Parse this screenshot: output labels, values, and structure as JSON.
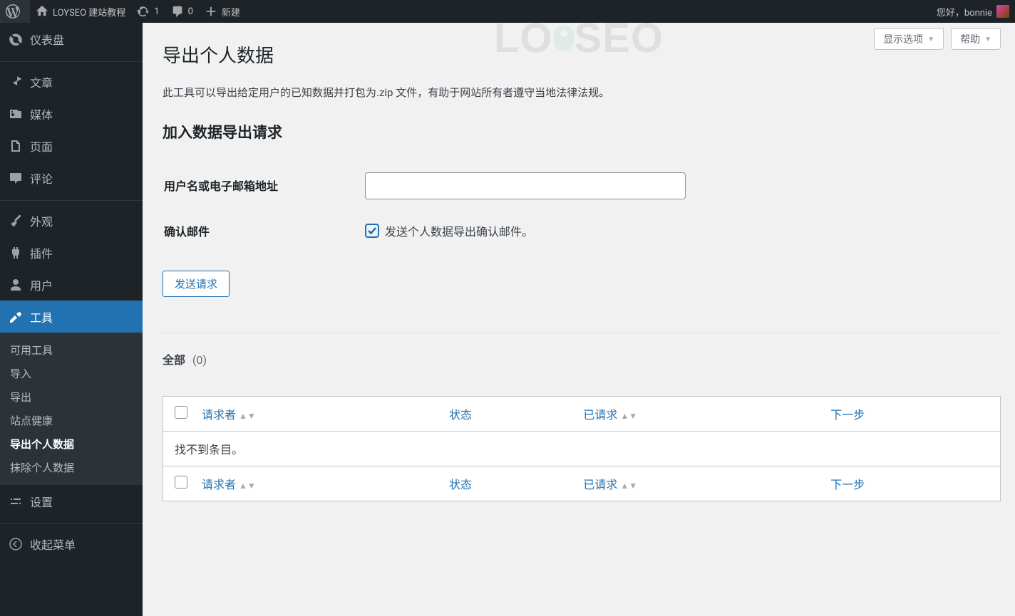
{
  "adminbar": {
    "site_name": "LOYSEO 建站教程",
    "updates_count": "1",
    "comments_count": "0",
    "new_label": "新建",
    "greeting": "您好，bonnie"
  },
  "sidebar": {
    "dashboard": "仪表盘",
    "posts": "文章",
    "media": "媒体",
    "pages": "页面",
    "comments": "评论",
    "appearance": "外观",
    "plugins": "插件",
    "users": "用户",
    "tools": "工具",
    "settings": "设置",
    "collapse": "收起菜单",
    "sub": {
      "available": "可用工具",
      "import": "导入",
      "export": "导出",
      "site_health": "站点健康",
      "export_personal": "导出个人数据",
      "erase_personal": "抹除个人数据"
    }
  },
  "buttons": {
    "screen_options": "显示选项",
    "help": "帮助"
  },
  "page": {
    "title": "导出个人数据",
    "desc": "此工具可以导出给定用户的已知数据并打包为.zip 文件，有助于网站所有者遵守当地法律法规。",
    "section_title": "加入数据导出请求",
    "username_label": "用户名或电子邮箱地址",
    "confirm_label": "确认邮件",
    "confirm_text": "发送个人数据导出确认邮件。",
    "send_button": "发送请求",
    "filter_all": "全部",
    "filter_count": "(0)"
  },
  "table": {
    "col_requester": "请求者",
    "col_status": "状态",
    "col_requested": "已请求",
    "col_next": "下一步",
    "no_items": "找不到条目。"
  },
  "watermark": {
    "a": "LO",
    "b": "SEO"
  }
}
